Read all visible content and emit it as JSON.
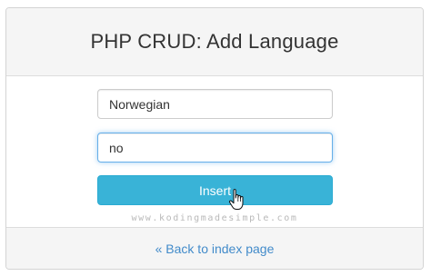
{
  "header": {
    "title": "PHP CRUD: Add Language"
  },
  "form": {
    "name_value": "Norwegian",
    "code_value": "no",
    "insert_label": "Insert"
  },
  "watermark": "www.kodingmadesimple.com",
  "footer": {
    "back_link": "« Back to index page"
  },
  "icons": {
    "cursor": "hand-pointer-icon"
  },
  "colors": {
    "button": "#39b3d7",
    "focus_border": "#66afe9",
    "link": "#428bca",
    "heading_bg": "#f5f5f5"
  }
}
